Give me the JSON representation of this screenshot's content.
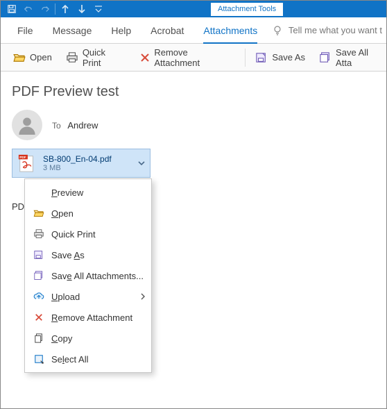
{
  "titlebar": {
    "context_tab": "Attachment Tools"
  },
  "menu": {
    "file": "File",
    "message": "Message",
    "help": "Help",
    "acrobat": "Acrobat",
    "attachments": "Attachments",
    "tellme": "Tell me what you want t"
  },
  "toolbar": {
    "open": "Open",
    "quick_print": "Quick Print",
    "remove": "Remove Attachment",
    "save_as": "Save As",
    "save_all": "Save All Atta"
  },
  "mail": {
    "subject": "PDF Preview test",
    "to_label": "To",
    "to_value": "Andrew",
    "attachment_name": "SB-800_En-04.pdf",
    "attachment_size": "3 MB",
    "body_snippet": "PDF"
  },
  "context_menu": {
    "preview": "Preview",
    "open": "Open",
    "quick_print": "Quick Print",
    "save_as": "Save As",
    "save_all": "Save All Attachments...",
    "upload": "Upload",
    "remove": "Remove Attachment",
    "copy": "Copy",
    "select_all": "Select All"
  }
}
